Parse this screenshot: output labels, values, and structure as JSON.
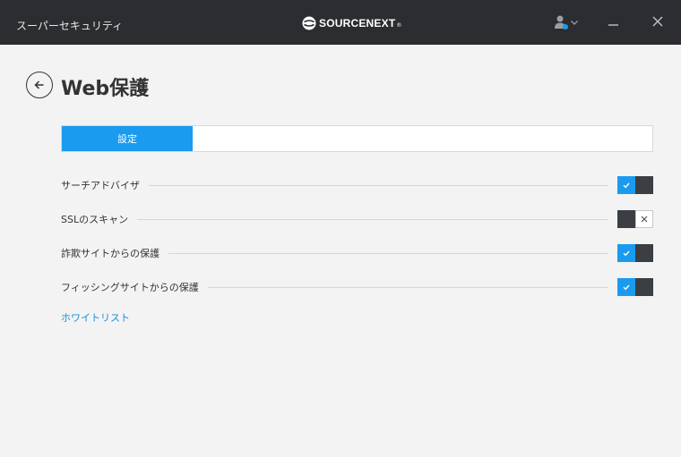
{
  "window": {
    "title": "スーパーセキュリティ",
    "brand": "SOURCENEXT",
    "brand_mark": "®"
  },
  "page": {
    "title": "Web保護"
  },
  "tabs": [
    {
      "label": "設定",
      "active": true
    }
  ],
  "settings": [
    {
      "label": "サーチアドバイザ",
      "enabled": true
    },
    {
      "label": "SSLのスキャン",
      "enabled": false
    },
    {
      "label": "詐欺サイトからの保護",
      "enabled": true
    },
    {
      "label": "フィッシングサイトからの保護",
      "enabled": true
    }
  ],
  "links": {
    "whitelist": "ホワイトリスト"
  },
  "colors": {
    "titlebar": "#2b2d30",
    "accent": "#1a9bf0",
    "toggle_dark": "#3b3e42",
    "background": "#f3f3f3"
  }
}
